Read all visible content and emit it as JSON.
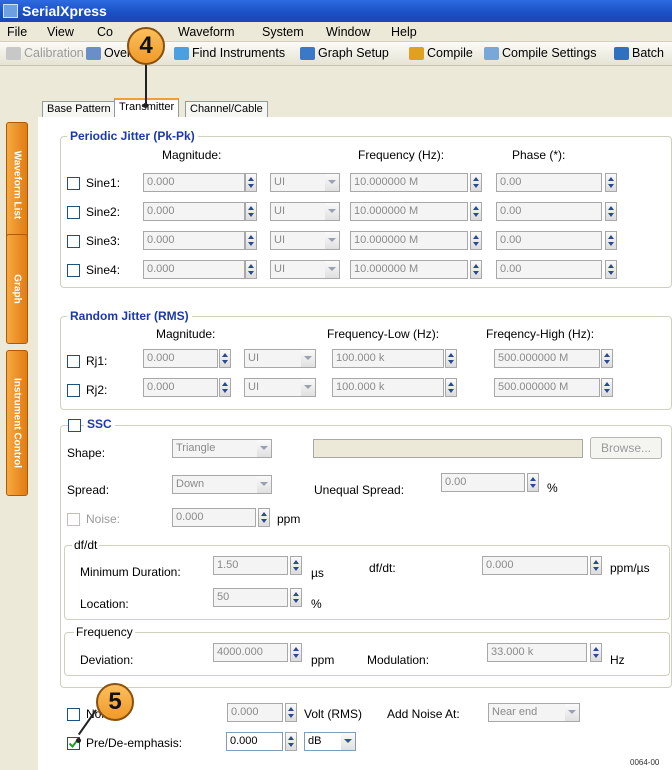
{
  "window": {
    "title": "SerialXpress"
  },
  "menu": [
    "File",
    "View",
    "Co",
    "Waveform",
    "System",
    "Window",
    "Help"
  ],
  "toolbar": [
    "Calibration",
    "Overview",
    "Find Instruments",
    "Graph Setup",
    "Compile",
    "Compile Settings",
    "Batch"
  ],
  "sidebar": [
    "Waveform List",
    "Graph",
    "Instrument Control"
  ],
  "tabs": [
    "Base Pattern",
    "Transmitter",
    "Channel/Cable"
  ],
  "callouts": [
    "4",
    "5"
  ],
  "periodic": {
    "title": "Periodic Jitter (Pk-Pk)",
    "h_mag": "Magnitude:",
    "h_freq": "Frequency (Hz):",
    "h_phase": "Phase (*):",
    "rows": [
      {
        "label": "Sine1:",
        "mag": "0.000",
        "unit": "UI",
        "freq": "10.000000 M",
        "phase": "0.00"
      },
      {
        "label": "Sine2:",
        "mag": "0.000",
        "unit": "UI",
        "freq": "10.000000 M",
        "phase": "0.00"
      },
      {
        "label": "Sine3:",
        "mag": "0.000",
        "unit": "UI",
        "freq": "10.000000 M",
        "phase": "0.00"
      },
      {
        "label": "Sine4:",
        "mag": "0.000",
        "unit": "UI",
        "freq": "10.000000 M",
        "phase": "0.00"
      }
    ]
  },
  "random": {
    "title": "Random Jitter (RMS)",
    "h_mag": "Magnitude:",
    "h_flow": "Frequency-Low (Hz):",
    "h_fhigh": "Freqency-High (Hz):",
    "rows": [
      {
        "label": "Rj1:",
        "mag": "0.000",
        "unit": "UI",
        "low": "100.000 k",
        "high": "500.000000 M"
      },
      {
        "label": "Rj2:",
        "mag": "0.000",
        "unit": "UI",
        "low": "100.000 k",
        "high": "500.000000 M"
      }
    ]
  },
  "ssc": {
    "title": "SSC",
    "shape_label": "Shape:",
    "shape": "Triangle",
    "browse": "Browse...",
    "spread_label": "Spread:",
    "spread": "Down",
    "unequal_label": "Unequal Spread:",
    "unequal": "0.00",
    "pct": "%",
    "noise_label": "Noise:",
    "noise": "0.000",
    "ppm": "ppm",
    "dfdt_title": "df/dt",
    "min_dur_label": "Minimum Duration:",
    "min_dur": "1.50",
    "us": "µs",
    "dfdt_label": "df/dt:",
    "dfdt": "0.000",
    "ppm_us": "ppm/µs",
    "loc_label": "Location:",
    "loc": "50",
    "loc_pct": "%",
    "freq_title": "Frequency",
    "dev_label": "Deviation:",
    "dev": "4000.000",
    "dev_unit": "ppm",
    "mod_label": "Modulation:",
    "mod": "33.000 k",
    "hz": "Hz"
  },
  "bottom": {
    "noise_label": "Noise:",
    "noise": "0.000",
    "volt": "Volt (RMS)",
    "add_noise_label": "Add Noise At:",
    "add_noise": "Near end",
    "pre_label": "Pre/De-emphasis:",
    "pre": "0.000",
    "pre_unit": "dB"
  },
  "figure_id": "0064-00"
}
